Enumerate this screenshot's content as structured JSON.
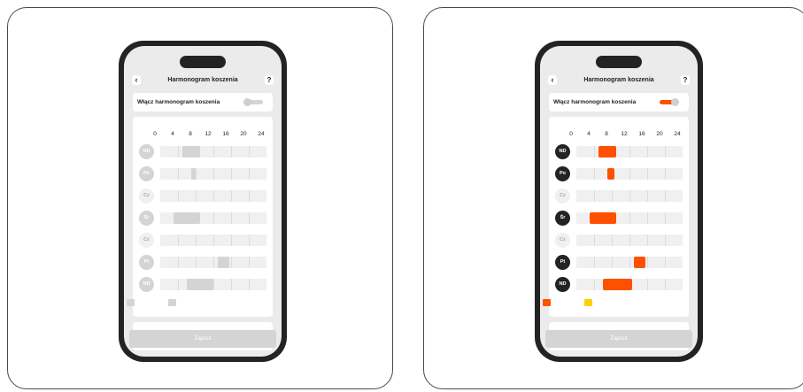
{
  "header": {
    "back_icon": "‹",
    "title": "Harmonogram koszenia",
    "help_icon": "?"
  },
  "toggle_label": "Włącz harmonogram koszenia",
  "hours": [
    "0",
    "4",
    "8",
    "12",
    "16",
    "20",
    "24"
  ],
  "days": [
    "ND",
    "Po",
    "Cz",
    "Śr",
    "Cz",
    "Pt",
    "ND"
  ],
  "save_label": "Zapisz",
  "colors": {
    "accent": "#ff5000",
    "legend_yellow": "#ffd000",
    "inactive": "#d4d4d4",
    "day_active": "#232323",
    "day_inactive_text": "#a8a8a8"
  },
  "left": {
    "toggle_on": false,
    "days_active": [
      false,
      false,
      false,
      false,
      false,
      false,
      false
    ],
    "schedule_hours": [
      [
        5,
        9
      ],
      [
        7,
        8
      ],
      null,
      [
        3,
        9
      ],
      null,
      [
        13,
        15.5
      ],
      [
        6,
        12
      ]
    ],
    "block_color": "#d4d4d4",
    "legend_colors": [
      "#d4d4d4",
      "#d4d4d4"
    ]
  },
  "right": {
    "toggle_on": true,
    "days_active": [
      true,
      true,
      false,
      true,
      false,
      true,
      true
    ],
    "schedule_hours": [
      [
        5,
        9
      ],
      [
        7,
        8.5
      ],
      null,
      [
        3,
        9
      ],
      null,
      [
        13,
        15.5
      ],
      [
        6,
        12.5
      ]
    ],
    "block_color": "#ff5000",
    "legend_colors": [
      "#ff5000",
      "#ffd000"
    ]
  }
}
